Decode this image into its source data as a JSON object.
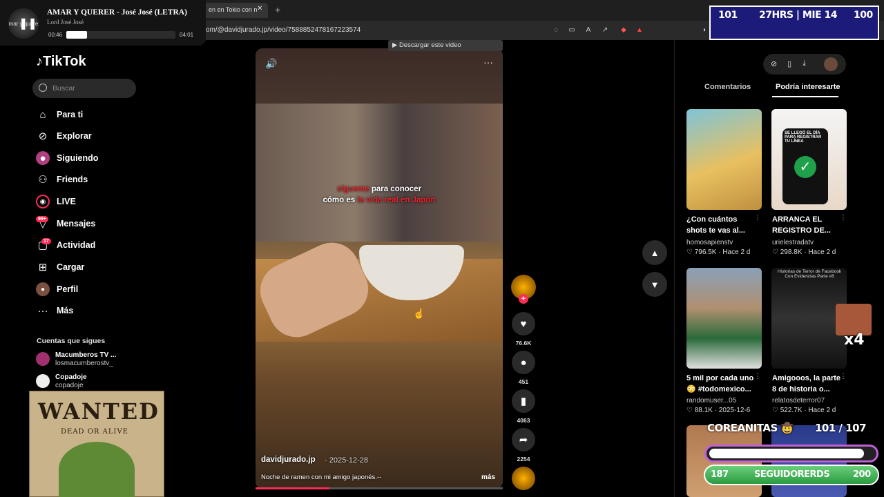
{
  "browser": {
    "tab_title": "en en Tokio con n",
    "tab_close": "✕",
    "new_tab": "+",
    "url": "om/@davidjurado.jp/video/7588852478167223574",
    "download_bar": "▶ Descargar este video"
  },
  "music": {
    "cover_text": "mar y quere",
    "title": "AMAR Y QUERER - José José (LETRA)",
    "artist": "Lord José José",
    "current": "00:46",
    "duration": "04:01",
    "progress": 0.19
  },
  "hud": {
    "left": "101",
    "center": "27HRS | MIE 14",
    "right": "100"
  },
  "sidebar": {
    "logo": "TikTok",
    "search_placeholder": "Buscar",
    "items": [
      {
        "label": "Para ti",
        "icon": "home-icon"
      },
      {
        "label": "Explorar",
        "icon": "compass-icon"
      },
      {
        "label": "Siguiendo",
        "icon": "following-icon"
      },
      {
        "label": "Friends",
        "icon": "friends-icon"
      },
      {
        "label": "LIVE",
        "icon": "live-icon"
      },
      {
        "label": "Mensajes",
        "icon": "messages-icon",
        "badge": "99+"
      },
      {
        "label": "Actividad",
        "icon": "activity-icon",
        "badge": "17"
      },
      {
        "label": "Cargar",
        "icon": "upload-icon"
      },
      {
        "label": "Perfil",
        "icon": "profile-icon"
      },
      {
        "label": "Más",
        "icon": "more-icon"
      }
    ],
    "following_header": "Cuentas que sigues",
    "following": [
      {
        "name": "Macumberos TV ...",
        "user": "losmacumberostv_"
      },
      {
        "name": "Copadoje",
        "user": "copadoje"
      }
    ]
  },
  "poster": {
    "title": "WANTED",
    "subtitle": "DEAD OR ALIVE"
  },
  "video": {
    "caption_line1_red": "sígueme",
    "caption_line1": " para conocer",
    "caption_line2": "cómo es ",
    "caption_line2_red": "la vida real en Japón",
    "author": "davidjurado.jp",
    "date": "· 2025-12-28",
    "description": "Noche de ramen con mi amigo japonés.--",
    "more": "más",
    "progress": 0.3
  },
  "actions": {
    "likes": "76.6K",
    "comments": "451",
    "saves": "4063",
    "shares": "2254"
  },
  "right_panel": {
    "tabs": [
      "Comentarios",
      "Podría interesarte"
    ],
    "cards": [
      {
        "title": "¿Con cuántos shots te vas al...",
        "user": "homosapienstv",
        "stats": "♡ 796.5K · Hace 2 d",
        "thumb": "#e8c060"
      },
      {
        "title": "ARRANCA EL REGISTRO DE...",
        "user": "urielestradatv",
        "stats": "♡ 298.8K · Hace 2 d",
        "thumb": "#f0f0f0"
      },
      {
        "title": "5 mil por cada uno 😳 #todomexico...",
        "user": "randomuser...05",
        "stats": "♡ 88.1K · 2025-12-6",
        "thumb": "#8aa0b8"
      },
      {
        "title": "Amigooos, la parte 8 de historia o...",
        "user": "relatosdeterror07",
        "stats": "♡ 522.7K · Hace 2 d",
        "thumb": "#2a2a2a"
      }
    ],
    "thumb_text_2": "SE LLEGÓ EL DÍA PARA REGISTRAR TU LÍNEA",
    "thumb_text_4": "Historias de Terror de Facebook Con Evidencias Parte #8"
  },
  "overlay": {
    "x4": "x4",
    "goal_name": "COREANITAS 🤠",
    "goal_count": "101 / 107",
    "goal_progress": 0.94,
    "followers_left": "187",
    "followers_label": "SEGUIDORERDS",
    "followers_right": "200"
  }
}
